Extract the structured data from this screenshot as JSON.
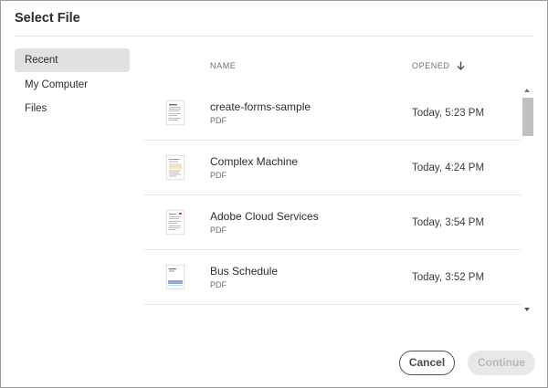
{
  "dialog": {
    "title": "Select File"
  },
  "sidebar": {
    "items": [
      {
        "label": "Recent",
        "active": true
      },
      {
        "label": "My Computer",
        "active": false
      },
      {
        "label": "Files",
        "active": false
      }
    ]
  },
  "list": {
    "columns": {
      "name": "NAME",
      "opened": "OPENED",
      "sort_icon": "arrow-down-icon"
    },
    "files": [
      {
        "name": "create-forms-sample",
        "type": "PDF",
        "opened": "Today, 5:23 PM",
        "thumb_icon": "pdf-thumbnail-icon"
      },
      {
        "name": "Complex Machine",
        "type": "PDF",
        "opened": "Today, 4:24 PM",
        "thumb_icon": "pdf-thumbnail-icon"
      },
      {
        "name": "Adobe Cloud Services",
        "type": "PDF",
        "opened": "Today, 3:54 PM",
        "thumb_icon": "pdf-thumbnail-icon"
      },
      {
        "name": "Bus Schedule",
        "type": "PDF",
        "opened": "Today, 3:52 PM",
        "thumb_icon": "pdf-thumbnail-icon"
      }
    ]
  },
  "footer": {
    "cancel_label": "Cancel",
    "continue_label": "Continue",
    "continue_enabled": false
  },
  "colors": {
    "active_item_bg": "#e1e1e1",
    "disabled_button_bg": "#e8e8e8",
    "cancel_border": "#505050"
  }
}
